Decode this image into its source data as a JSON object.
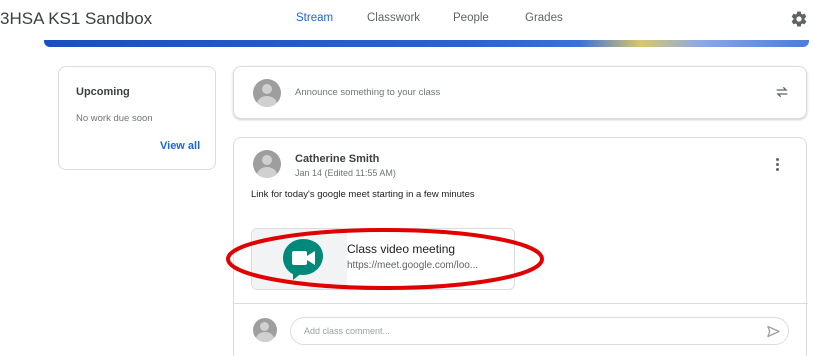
{
  "header": {
    "class_title": "3HSA KS1 Sandbox",
    "tabs": [
      {
        "label": "Stream",
        "active": true
      },
      {
        "label": "Classwork",
        "active": false
      },
      {
        "label": "People",
        "active": false
      },
      {
        "label": "Grades",
        "active": false
      }
    ],
    "settings_icon": "gear-icon"
  },
  "upcoming": {
    "title": "Upcoming",
    "subtitle": "No work due soon",
    "link": "View all"
  },
  "announce": {
    "placeholder": "Announce something to your class",
    "icon": "repost-icon"
  },
  "post": {
    "author": "Catherine Smith",
    "date": "Jan 14 (Edited 11:55 AM)",
    "text": "Link for today's google meet starting in a few minutes",
    "attachment": {
      "title": "Class video meeting",
      "url": "https://meet.google.com/loo...",
      "icon": "google-meet-icon"
    },
    "comment_placeholder": "Add class comment..."
  },
  "colors": {
    "accent": "#1967d2",
    "highlight": "#e00000",
    "meet_teal": "#00897b"
  }
}
